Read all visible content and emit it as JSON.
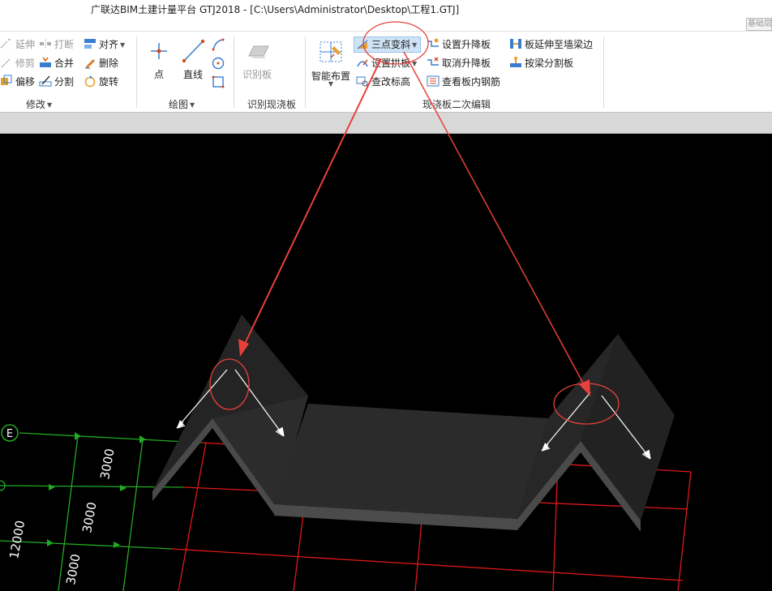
{
  "window": {
    "title": "广联达BIM土建计量平台 GTJ2018 - [C:\\Users\\Administrator\\Desktop\\工程1.GTJ]",
    "top_right_label": "基础层"
  },
  "ribbon": {
    "modify": {
      "extend": "延伸",
      "break": "打断",
      "align": "对齐",
      "trim": "修剪",
      "merge": "合并",
      "delete": "删除",
      "offset": "偏移",
      "split": "分割",
      "rotate": "旋转",
      "label": "修改"
    },
    "draw": {
      "point": "点",
      "line": "直线",
      "label": "绘图"
    },
    "identify": {
      "identify_slab": "识别板",
      "label": "识别现浇板"
    },
    "slab_edit": {
      "smart_layout": "智能布置",
      "three_point_slope": "三点变斜",
      "set_arch_slab": "设置拱板",
      "check_elevation": "查改标高",
      "set_drop_slab": "设置升降板",
      "cancel_drop_slab": "取消升降板",
      "view_slab_rebar": "查看板内钢筋",
      "extend_to_beam": "板延伸至墙梁边",
      "split_by_beam": "按梁分割板",
      "label": "现浇板二次编辑"
    }
  },
  "viewport": {
    "axis_label": "E",
    "dims": [
      "3000",
      "3000",
      "3000",
      "12000"
    ]
  },
  "colors": {
    "highlight": "#e8403a",
    "grid_red": "#e01818",
    "grid_green": "#22aa22",
    "slab_face": "#2a2a2a",
    "slab_edge": "#4a4a4a"
  }
}
